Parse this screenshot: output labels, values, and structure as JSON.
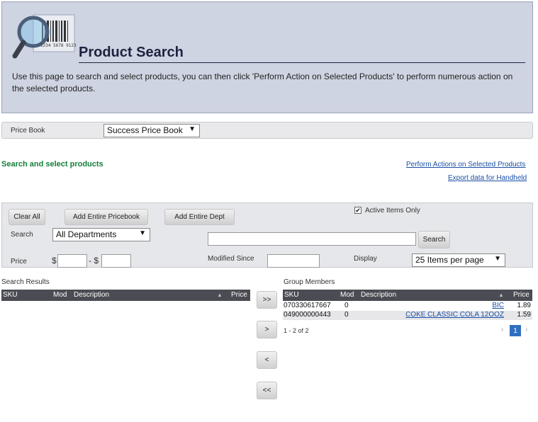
{
  "header": {
    "title": "Product Search",
    "intro": "Use this page to search and select products, you can then click 'Perform Action on Selected Products' to perform numerous action on the selected products.",
    "logo_icon": "barcode-magnifier-icon",
    "barcode_number": "1234 5678 9123"
  },
  "pricebook": {
    "label": "Price Book",
    "selected": "Success Price Book"
  },
  "section": {
    "title": "Search and select products",
    "actions_link": "Perform Actions on Selected Products",
    "export_link": "Export data for Handheld"
  },
  "search_panel": {
    "clear_all": "Clear All",
    "add_pricebook": "Add Entire Pricebook",
    "add_dept": "Add Entire Dept",
    "active_only_label": "Active Items Only",
    "active_only_checked": true,
    "search_label": "Search",
    "department_selected": "All Departments",
    "search_value": "",
    "search_button": "Search",
    "price_label": "Price",
    "price_from_symbol": "$",
    "price_separator": "- $",
    "price_from": "",
    "price_to": "",
    "modified_label": "Modified Since",
    "modified_value": "",
    "display_label": "Display",
    "display_selected": "25 Items per page"
  },
  "search_results": {
    "title": "Search Results",
    "columns": {
      "sku": "SKU",
      "mod": "Mod",
      "description": "Description",
      "price": "Price"
    }
  },
  "transfer_buttons": {
    "add_all": ">>",
    "add_selected": ">",
    "remove_selected": "<",
    "remove_all": "<<"
  },
  "group_members": {
    "title": "Group Members",
    "columns": {
      "sku": "SKU",
      "mod": "Mod",
      "description": "Description",
      "price": "Price"
    },
    "rows": [
      {
        "sku": "070330617667",
        "mod": "0",
        "description": "BIC",
        "price": "1.89"
      },
      {
        "sku": "049000000443",
        "mod": "0",
        "description": "COKE CLASSIC COLA 12OOZ",
        "price": "1.59"
      }
    ],
    "pagination_summary": "1 - 2 of 2",
    "current_page": "1",
    "prev_symbol": "‹",
    "next_symbol": "›"
  },
  "colors": {
    "header_bg": "#cfd4e2",
    "title": "#1c2340",
    "section_title": "#13803a",
    "link": "#1a4fa6",
    "table_head": "#4b4c53",
    "pager_active": "#2f6fbf"
  }
}
